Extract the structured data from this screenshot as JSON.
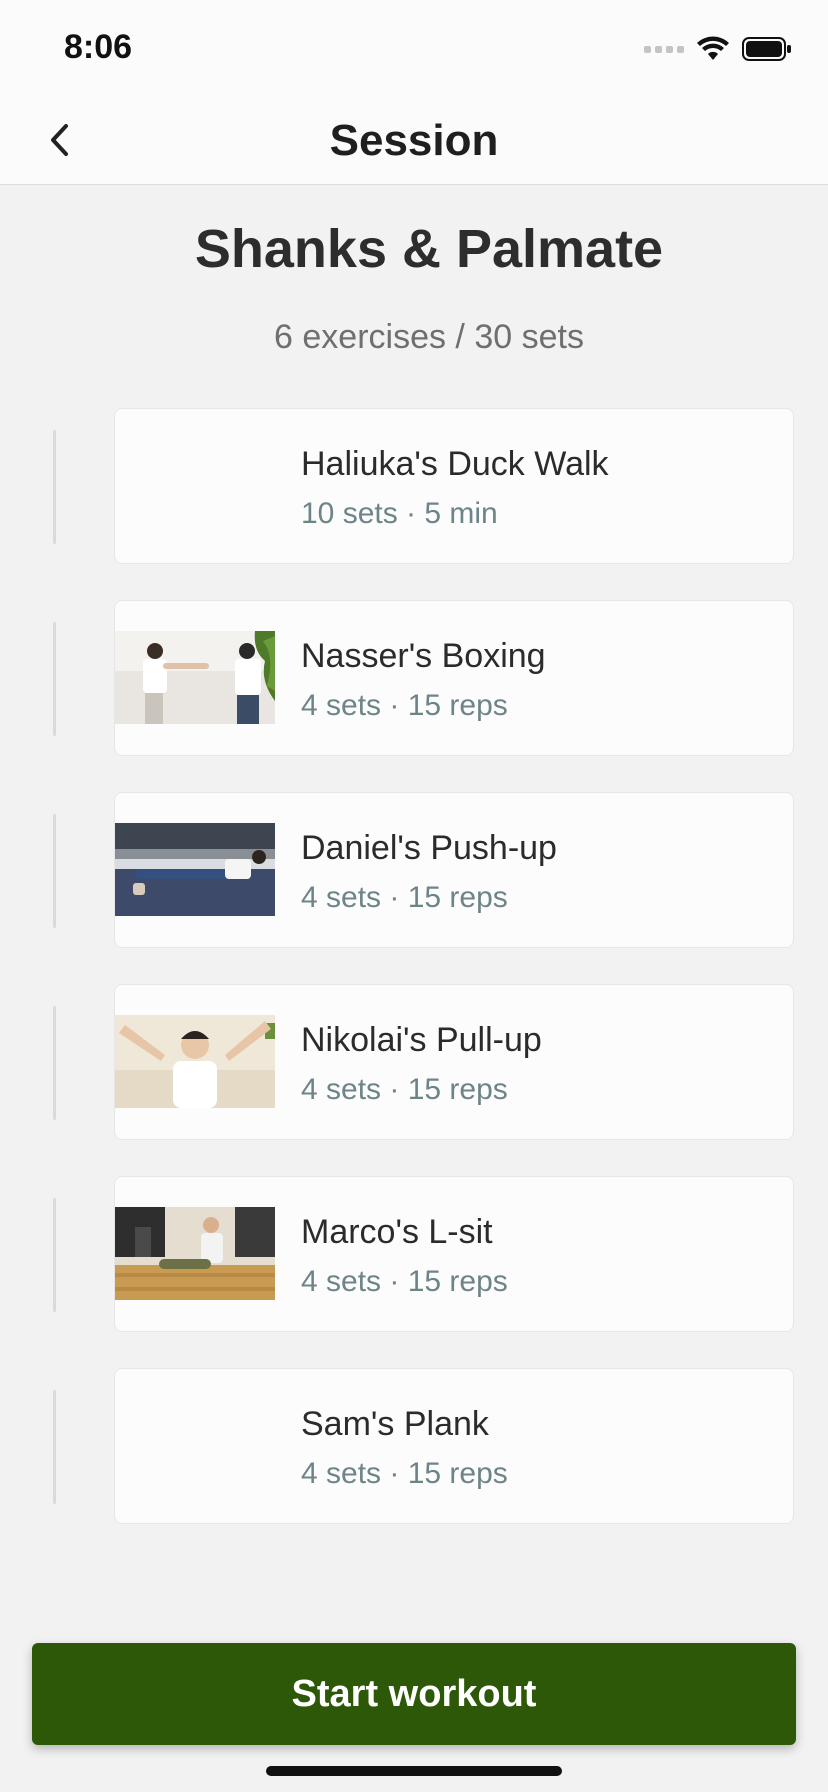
{
  "status_bar": {
    "time": "8:06"
  },
  "nav": {
    "title": "Session",
    "back_icon": "chevron-left-icon"
  },
  "session": {
    "title": "Shanks & Palmate",
    "summary": "6 exercises / 30 sets"
  },
  "exercises": [
    {
      "name": "Haliuka's Duck Walk",
      "meta": "10 sets · 5 min",
      "has_thumbnail": false
    },
    {
      "name": "Nasser's Boxing",
      "meta": "4 sets · 15 reps",
      "has_thumbnail": true
    },
    {
      "name": "Daniel's Push-up",
      "meta": "4 sets · 15 reps",
      "has_thumbnail": true
    },
    {
      "name": "Nikolai's Pull-up",
      "meta": "4 sets · 15 reps",
      "has_thumbnail": true
    },
    {
      "name": "Marco's L-sit",
      "meta": "4 sets · 15 reps",
      "has_thumbnail": true
    },
    {
      "name": "Sam's Plank",
      "meta": "4 sets · 15 reps",
      "has_thumbnail": false
    }
  ],
  "footer": {
    "start_label": "Start workout"
  },
  "colors": {
    "primary_button": "#2d5808",
    "meta_text": "#6d8489",
    "background": "#f2f2f2"
  }
}
